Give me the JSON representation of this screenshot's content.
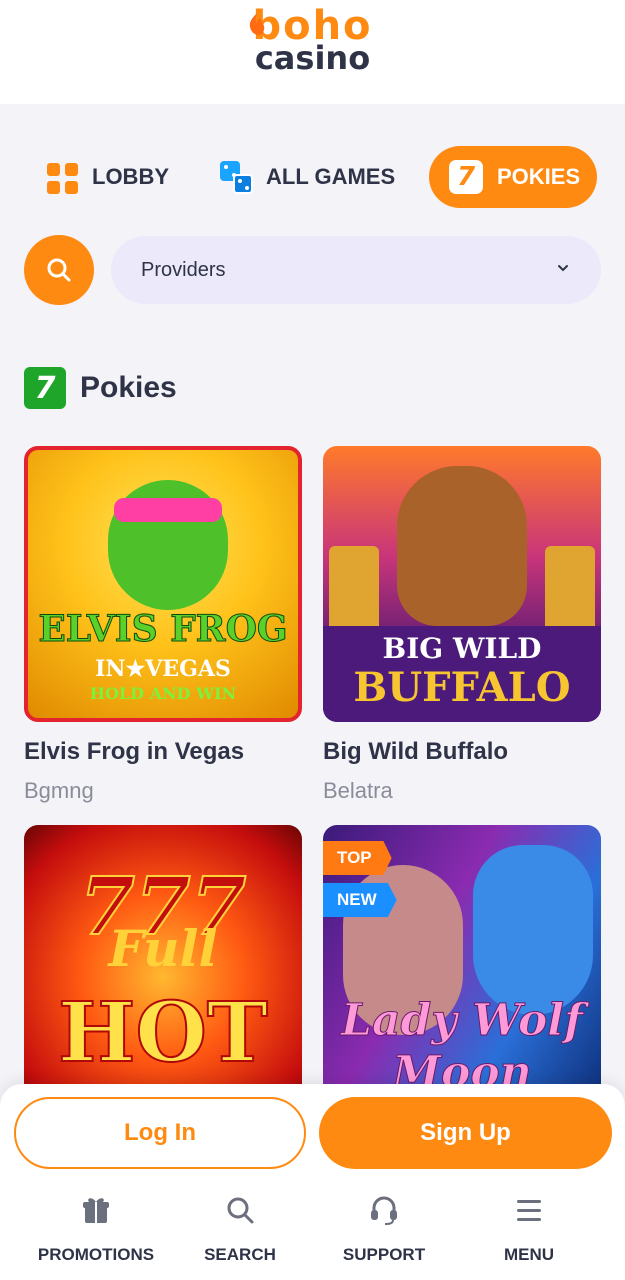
{
  "brand": {
    "logo_top": "boho",
    "logo_bottom": "casino",
    "accent": "#ff8a12",
    "text_dark": "#2f3347",
    "section_icon_green": "#1fa52a"
  },
  "tabs": [
    {
      "label": "LOBBY",
      "icon": "lobby-grid-icon",
      "active": false
    },
    {
      "label": "ALL GAMES",
      "icon": "dice-icon",
      "active": false
    },
    {
      "label": "POKIES",
      "icon": "seven-icon",
      "active": true
    }
  ],
  "search": {
    "icon": "search-icon"
  },
  "providers": {
    "selected": "Providers",
    "icon": "chevron-down-icon"
  },
  "section": {
    "icon_glyph": "7",
    "title": "Pokies"
  },
  "games": [
    {
      "name": "Elvis Frog in Vegas",
      "provider": "Bgmng",
      "art_line1": "ELVIS FROG",
      "art_line2": "IN★VEGAS",
      "art_line3": "HOLD AND WIN"
    },
    {
      "name": "Big Wild Buffalo",
      "provider": "Belatra",
      "art_line1": "BIG WILD",
      "art_line2": "BUFFALO"
    },
    {
      "name": "",
      "provider": "",
      "art_line1": "777",
      "art_line2": "Full",
      "art_line3": "HOT"
    },
    {
      "name": "",
      "provider": "",
      "art_line1": "Lady Wolf",
      "art_line2": "Moon",
      "badge_top": "TOP",
      "badge_new": "NEW"
    }
  ],
  "auth": {
    "login_label": "Log In",
    "signup_label": "Sign Up"
  },
  "bottom_nav": [
    {
      "label": "PROMOTIONS",
      "icon": "gift-icon"
    },
    {
      "label": "SEARCH",
      "icon": "search-icon"
    },
    {
      "label": "SUPPORT",
      "icon": "headset-icon"
    },
    {
      "label": "MENU",
      "icon": "hamburger-icon"
    }
  ]
}
